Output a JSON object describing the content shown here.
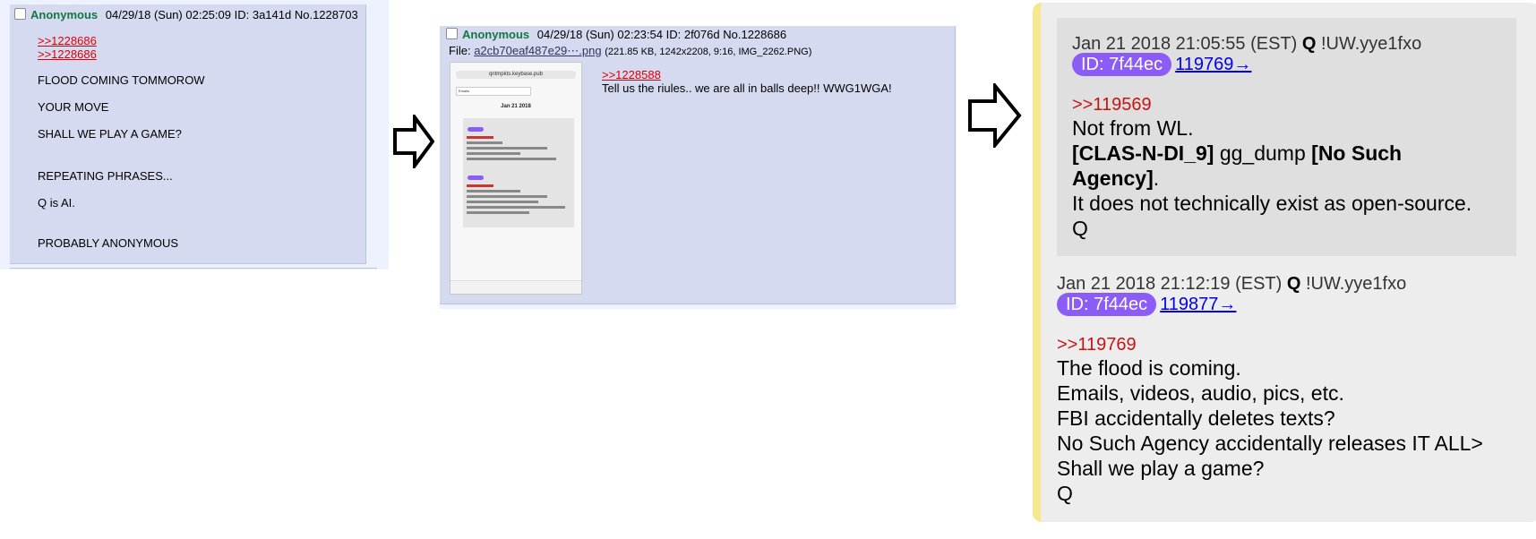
{
  "post1": {
    "name": "Anonymous",
    "datetime": "04/29/18 (Sun) 02:25:09",
    "id": "ID: 3a141d",
    "number": "No.1228703",
    "quotes": [
      ">>1228686",
      ">>1228686"
    ],
    "lines": [
      "FLOOD COMING TOMMOROW",
      "YOUR MOVE",
      "SHALL WE PLAY A GAME?",
      "REPEATING PHRASES...",
      "Q is AI.",
      "PROBABLY ANONYMOUS"
    ]
  },
  "post2": {
    "name": "Anonymous",
    "datetime": "04/29/18 (Sun) 02:23:54",
    "id": "ID: 2f076d",
    "number": "No.1228686",
    "file_label": "File:",
    "file_name": "a2cb70eaf487e29⋯.png",
    "file_meta": "(221.85 KB, 1242x2208, 9:16, IMG_2262.PNG)",
    "quote": ">>1228588",
    "text": "Tell us the riules.. we are all in balls deep!!  WWG1WGA!",
    "thumb": {
      "url": "qntmpkts.keybase.pub",
      "search": "Emails",
      "date": "Jan 21 2018"
    }
  },
  "post3": {
    "entries": [
      {
        "datetime": "Jan 21 2018 21:05:55 (EST)",
        "author": "Q",
        "trip": "!UW.yye1fxo",
        "id_pill": "ID: 7f44ec",
        "link": "119769→",
        "quote": ">>119569",
        "line1": "Not from WL.",
        "line2a": "[CLAS-N-DI_9]",
        "line2b": " gg_dump ",
        "line2c": "[No Such",
        "line3a": "Agency]",
        "line3b": ".",
        "line4": "It does not technically exist as open-source.",
        "line5": "Q"
      },
      {
        "datetime": "Jan 21 2018 21:12:19 (EST)",
        "author": "Q",
        "trip": "!UW.yye1fxo",
        "id_pill": "ID: 7f44ec",
        "link": "119877→",
        "quote": ">>119769",
        "lines": [
          "The flood is coming.",
          "Emails, videos, audio, pics, etc.",
          "FBI accidentally deletes texts?",
          "No Such Agency accidentally releases IT ALL>",
          "Shall we play a game?",
          "Q"
        ]
      }
    ]
  },
  "colors": {
    "post_bg": "#d6daf0",
    "name_green": "#117743",
    "quote_red": "#dd0000",
    "id_pill_purple": "#8b5cf6",
    "card_accent": "#f5e88f"
  }
}
